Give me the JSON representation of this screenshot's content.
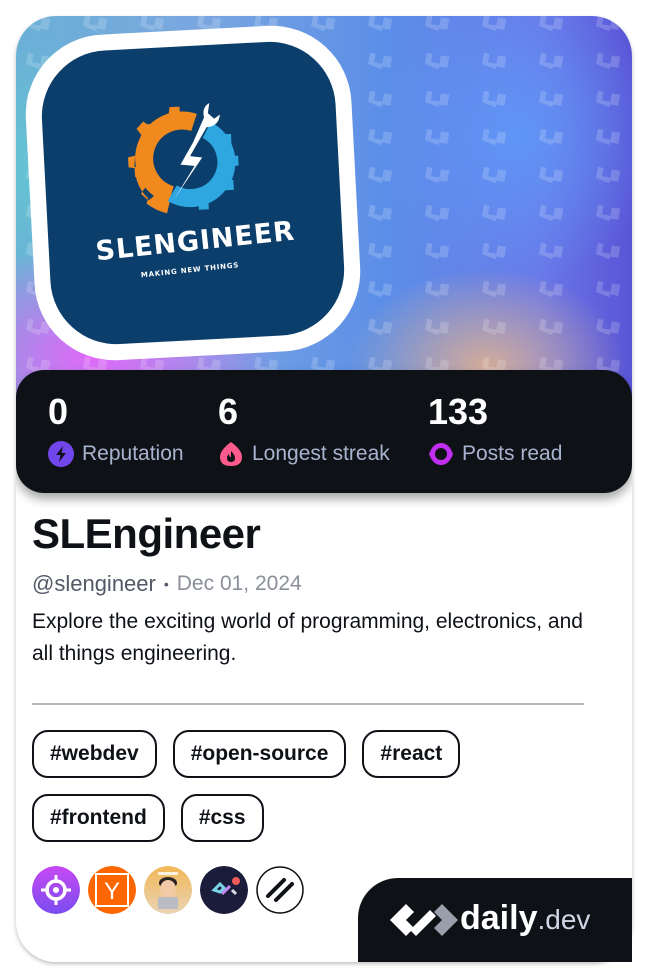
{
  "profile": {
    "avatar_alt": "SLEngineer logo",
    "avatar_logo_text": "SLENGINEER",
    "avatar_logo_tagline": "MAKING NEW THINGS",
    "name": "SLEngineer",
    "handle": "@slengineer",
    "separator": "•",
    "joined_date": "Dec 01, 2024",
    "bio": "Explore the exciting world of programming, electronics, and all things engineering."
  },
  "stats": [
    {
      "value": "0",
      "label": "Reputation",
      "icon": "lightning-icon",
      "color": "#7147ed"
    },
    {
      "value": "6",
      "label": "Longest streak",
      "icon": "flame-icon",
      "color": "#ff5a8c"
    },
    {
      "value": "133",
      "label": "Posts read",
      "icon": "ring-icon",
      "color": "#c02ef0"
    }
  ],
  "tags": [
    "#webdev",
    "#open-source",
    "#react",
    "#frontend",
    "#css"
  ],
  "sources": [
    {
      "name": "crosshair-source",
      "icon": "crosshair-icon",
      "color": "#a240f0"
    },
    {
      "name": "hacker-news-source",
      "icon": "y-icon",
      "letter": "Y",
      "color": "#ff6600"
    },
    {
      "name": "user-avatar-source",
      "icon": "memoji-avatar-icon",
      "color": "#e8b86a"
    },
    {
      "name": "daily-dev-source",
      "icon": "daily-dev-icon",
      "color": "#1a1c3a"
    },
    {
      "name": "slash-source",
      "icon": "double-slash-icon",
      "color": "#ffffff"
    }
  ],
  "brand": {
    "name": "daily",
    "tld": ".dev"
  }
}
